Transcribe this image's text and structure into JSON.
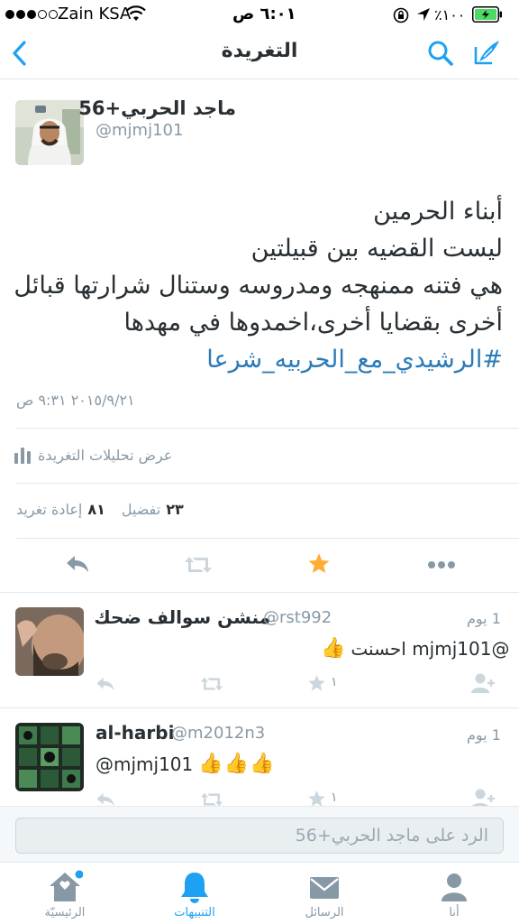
{
  "status_bar": {
    "carrier": "Zain KSA",
    "time": "٦:٠١ ص",
    "battery": "٪١٠٠"
  },
  "nav": {
    "title": "التغريدة",
    "back_icon": "chevron-left-icon",
    "search_icon": "search-icon",
    "compose_icon": "compose-tweet-icon"
  },
  "tweet": {
    "name": "ماجد الحربي+56",
    "handle": "@mjmj101",
    "lines": [
      "أبناء الحرمين",
      "ليست القضيه بين قبيلتين",
      "هي فتنه ممنهجه ومدروسه وستنال شرارتها قبائل",
      "أخرى بقضايا أخرى،اخمدوها في مهدها"
    ],
    "hashtag": "#الرشيدي_مع_الحربيه_شرعا",
    "timestamp": "٢٠١٥/٩/٢١ ٩:٣١ ص",
    "analytics_label": "عرض تحليلات التغريدة",
    "favorites_count": "٢٣",
    "favorites_label": "تفضيل",
    "retweets_count": "٨١",
    "retweets_label": "إعادة تغريد",
    "favorited": true
  },
  "replies": [
    {
      "name": "منشن سوالف ضحك",
      "handle": "@rst992",
      "time": "1 يوم",
      "text": "@mjmj101 احسنت",
      "emoji": "👍",
      "favorite_count": "١"
    },
    {
      "name": "al-harbi",
      "handle": "@m2012n3",
      "time": "1 يوم",
      "text": "@mjmj101",
      "emoji": "👍👍👍",
      "favorite_count": "١"
    }
  ],
  "reply_bar": {
    "placeholder": "الرد على ماجد الحربي+56"
  },
  "tabs": [
    {
      "label": "الرئيسيّة",
      "icon": "home-icon",
      "active": false,
      "has_dot": true
    },
    {
      "label": "التنبيهات",
      "icon": "bell-icon",
      "active": true,
      "has_dot": false
    },
    {
      "label": "الرسائل",
      "icon": "envelope-icon",
      "active": false,
      "has_dot": false
    },
    {
      "label": "أنا",
      "icon": "person-icon",
      "active": false,
      "has_dot": false
    }
  ],
  "colors": {
    "accent": "#1da1f2",
    "link": "#2b7bb9",
    "favorite": "#ffac33",
    "muted": "#8899a6",
    "battery": "#4cd964"
  }
}
